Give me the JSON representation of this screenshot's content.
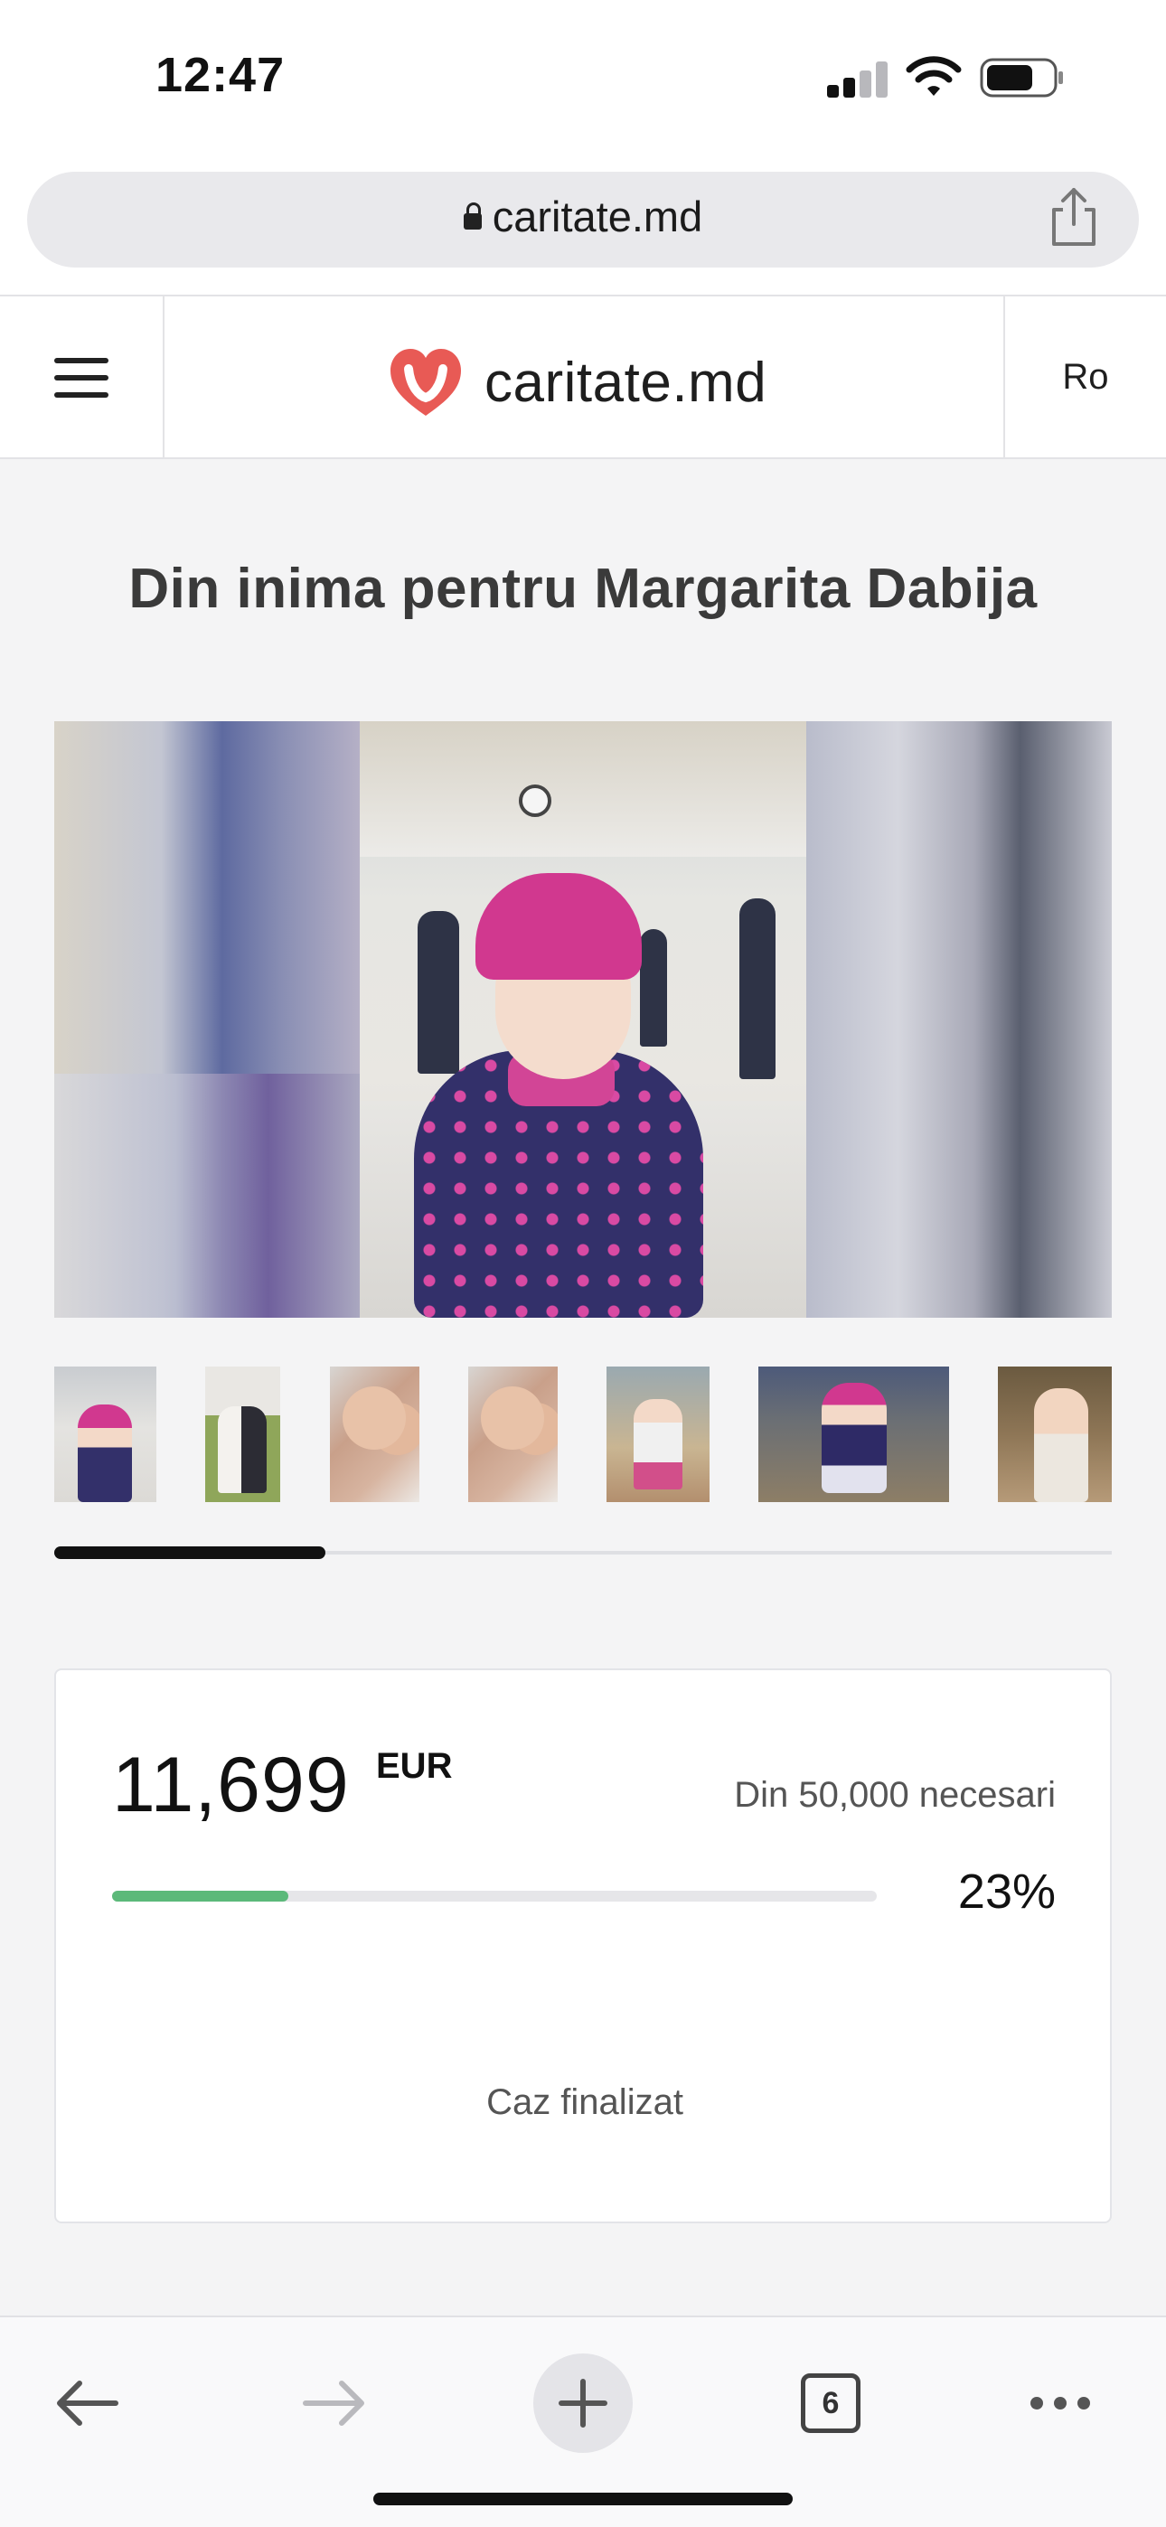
{
  "status_bar": {
    "time": "12:47",
    "signal_icon": "cellular-signal-icon",
    "wifi_icon": "wifi-icon",
    "battery_icon": "battery-icon"
  },
  "browser": {
    "url": "caritate.md",
    "lock_icon": "lock-icon",
    "share_icon": "share-icon",
    "tab_count": "6"
  },
  "site_header": {
    "menu_icon": "hamburger-menu-icon",
    "logo_text": "caritate.md",
    "logo_icon": "heart-logo-icon",
    "language": "Ro",
    "brand_color": "#e85a55"
  },
  "page": {
    "title": "Din inima pentru Margarita Dabija"
  },
  "gallery": {
    "thumbnail_count": 7,
    "scroll_position": 0.26
  },
  "donation": {
    "raised": "11,699",
    "currency": "EUR",
    "goal_text": "Din 50,000 necesari",
    "progress_fraction": 0.23,
    "percent_text": "23%",
    "status_text": "Caz finalizat",
    "progress_color": "#5cb97a"
  },
  "toolbar": {
    "back_icon": "back-arrow-icon",
    "forward_icon": "forward-arrow-icon",
    "new_tab_icon": "plus-icon",
    "tabs_icon": "tabs-icon",
    "more_icon": "more-dots-icon"
  }
}
